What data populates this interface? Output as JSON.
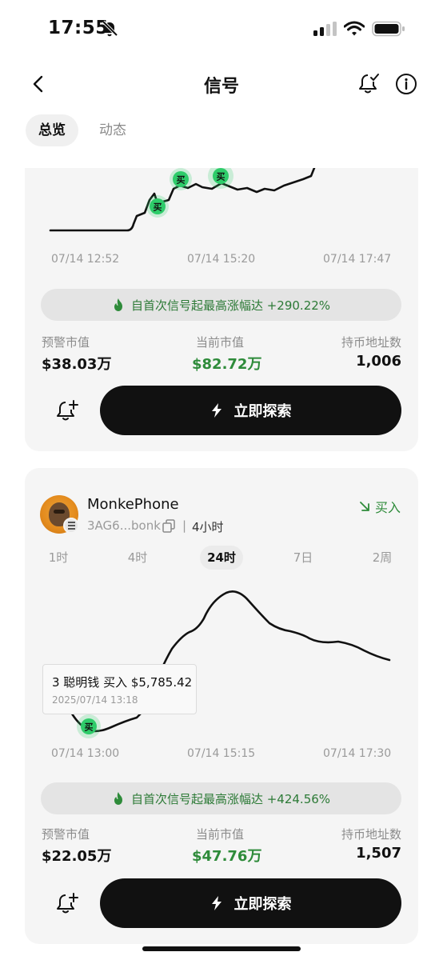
{
  "status_bar": {
    "time": "17:55"
  },
  "header": {
    "title": "信号"
  },
  "tabs": [
    {
      "label": "总览",
      "active": true
    },
    {
      "label": "动态",
      "active": false
    }
  ],
  "cards": [
    {
      "chart_data": {
        "type": "line",
        "x_ticks": [
          "07/14 12:52",
          "07/14 15:20",
          "07/14 17:47"
        ],
        "markers": [
          "买",
          "买",
          "买"
        ]
      },
      "gain_text": "自首次信号起最高涨幅达 +290.22%",
      "stats": [
        {
          "label": "预警市值",
          "value": "$38.03万"
        },
        {
          "label": "当前市值",
          "value": "$82.72万"
        },
        {
          "label": "持币地址数",
          "value": "1,006"
        }
      ],
      "explore_label": "立即探索"
    },
    {
      "token": {
        "name": "MonkePhone",
        "address": "3AG6...bonk",
        "separator": "|",
        "age": "4小时"
      },
      "action": {
        "label": "买入"
      },
      "range_tabs": [
        {
          "label": "1时",
          "active": false
        },
        {
          "label": "4时",
          "active": false
        },
        {
          "label": "24时",
          "active": true
        },
        {
          "label": "7日",
          "active": false
        },
        {
          "label": "2周",
          "active": false
        }
      ],
      "chart_data": {
        "type": "line",
        "x_ticks": [
          "07/14 13:00",
          "07/14 15:15",
          "07/14 17:30"
        ],
        "markers": [
          "买"
        ]
      },
      "tooltip": {
        "line1": "3 聪明钱 买入 $5,785.42",
        "line2": "2025/07/14 13:18"
      },
      "gain_text": "自首次信号起最高涨幅达 +424.56%",
      "stats": [
        {
          "label": "预警市值",
          "value": "$22.05万"
        },
        {
          "label": "当前市值",
          "value": "$47.76万"
        },
        {
          "label": "持币地址数",
          "value": "1,507"
        }
      ],
      "explore_label": "立即探索"
    }
  ],
  "colors": {
    "accent_green": "#2e8b3a",
    "marker_green": "#2ecc6a",
    "card_bg": "#f5f5f5",
    "button_bg": "#111111"
  }
}
